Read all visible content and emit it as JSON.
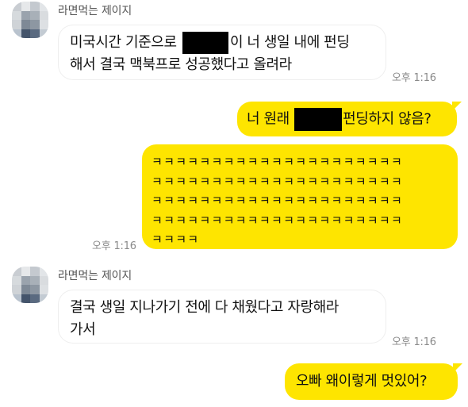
{
  "messages": [
    {
      "sender": "라면먹는 제이지",
      "text_before": "미국시간 기준으로",
      "text_after": "이 너 생일 내에 펀딩",
      "line2": "해서 결국 맥북프로 성공했다고 올려라",
      "time": "오후 1:16"
    },
    {
      "text_before": "너 원래",
      "text_after": "펀딩하지 않음?"
    },
    {
      "laugh_lines": [
        "ㅋㅋㅋㅋㅋㅋㅋㅋㅋㅋㅋㅋㅋㅋㅋㅋㅋㅋㅋㅋㅋ",
        "ㅋㅋㅋㅋㅋㅋㅋㅋㅋㅋㅋㅋㅋㅋㅋㅋㅋㅋㅋㅋㅋ",
        "ㅋㅋㅋㅋㅋㅋㅋㅋㅋㅋㅋㅋㅋㅋㅋㅋㅋㅋㅋㅋㅋ",
        "ㅋㅋㅋㅋㅋㅋㅋㅋㅋㅋㅋㅋㅋㅋㅋㅋㅋㅋㅋㅋㅋ",
        "ㅋㅋㅋㅋ"
      ],
      "time": "오후 1:16"
    },
    {
      "sender": "라면먹는 제이지",
      "line1": "결국 생일 지나가기 전에 다 채웠다고 자랑해라",
      "line2": "가서",
      "time": "오후 1:16"
    },
    {
      "text": "오빠 왜이렇게 멋있어?"
    }
  ],
  "colors": {
    "outgoing_bubble": "#fee500",
    "incoming_bubble": "#ffffff",
    "time_text": "#8a8a8a"
  }
}
